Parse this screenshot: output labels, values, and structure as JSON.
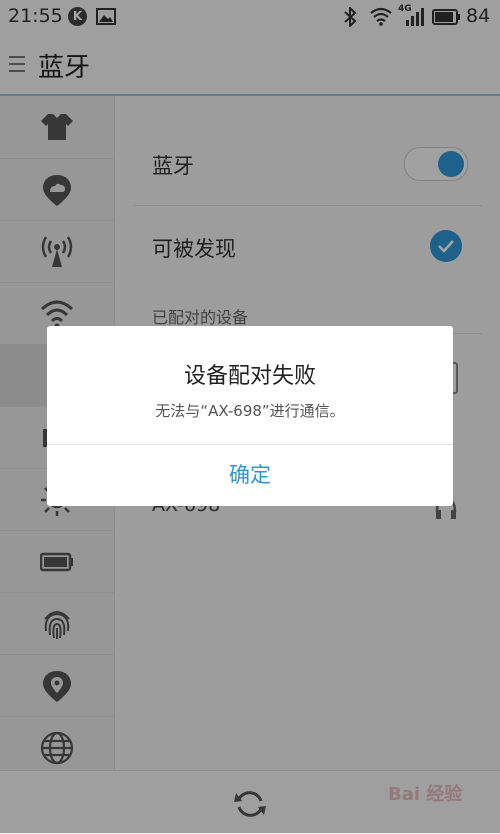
{
  "status_bar": {
    "time": "21:55",
    "notif_k": "K",
    "battery_level": "84",
    "network_type": "4G"
  },
  "header": {
    "title": "蓝牙"
  },
  "sidebar": {
    "items": [
      {
        "icon": "tshirt-icon"
      },
      {
        "icon": "cloud-location-icon"
      },
      {
        "icon": "hotspot-icon"
      },
      {
        "icon": "wifi-icon"
      },
      {
        "icon": "bluetooth-icon",
        "active": true
      },
      {
        "icon": "display-icon"
      },
      {
        "icon": "brightness-icon"
      },
      {
        "icon": "battery-icon"
      },
      {
        "icon": "fingerprint-icon"
      },
      {
        "icon": "location-icon"
      },
      {
        "icon": "globe-icon"
      }
    ]
  },
  "settings": {
    "bluetooth_label": "蓝牙",
    "bluetooth_on": true,
    "discoverable_label": "可被发现",
    "discoverable_checked": true,
    "paired_section": "已配对的设备",
    "device_name": "AX-698"
  },
  "dialog": {
    "title": "设备配对失败",
    "message": "无法与“AX-698”进行通信。",
    "confirm": "确定"
  },
  "watermark": "Bai 经验",
  "colors": {
    "accent": "#2f96d6",
    "header_border": "#8fc3e0"
  }
}
